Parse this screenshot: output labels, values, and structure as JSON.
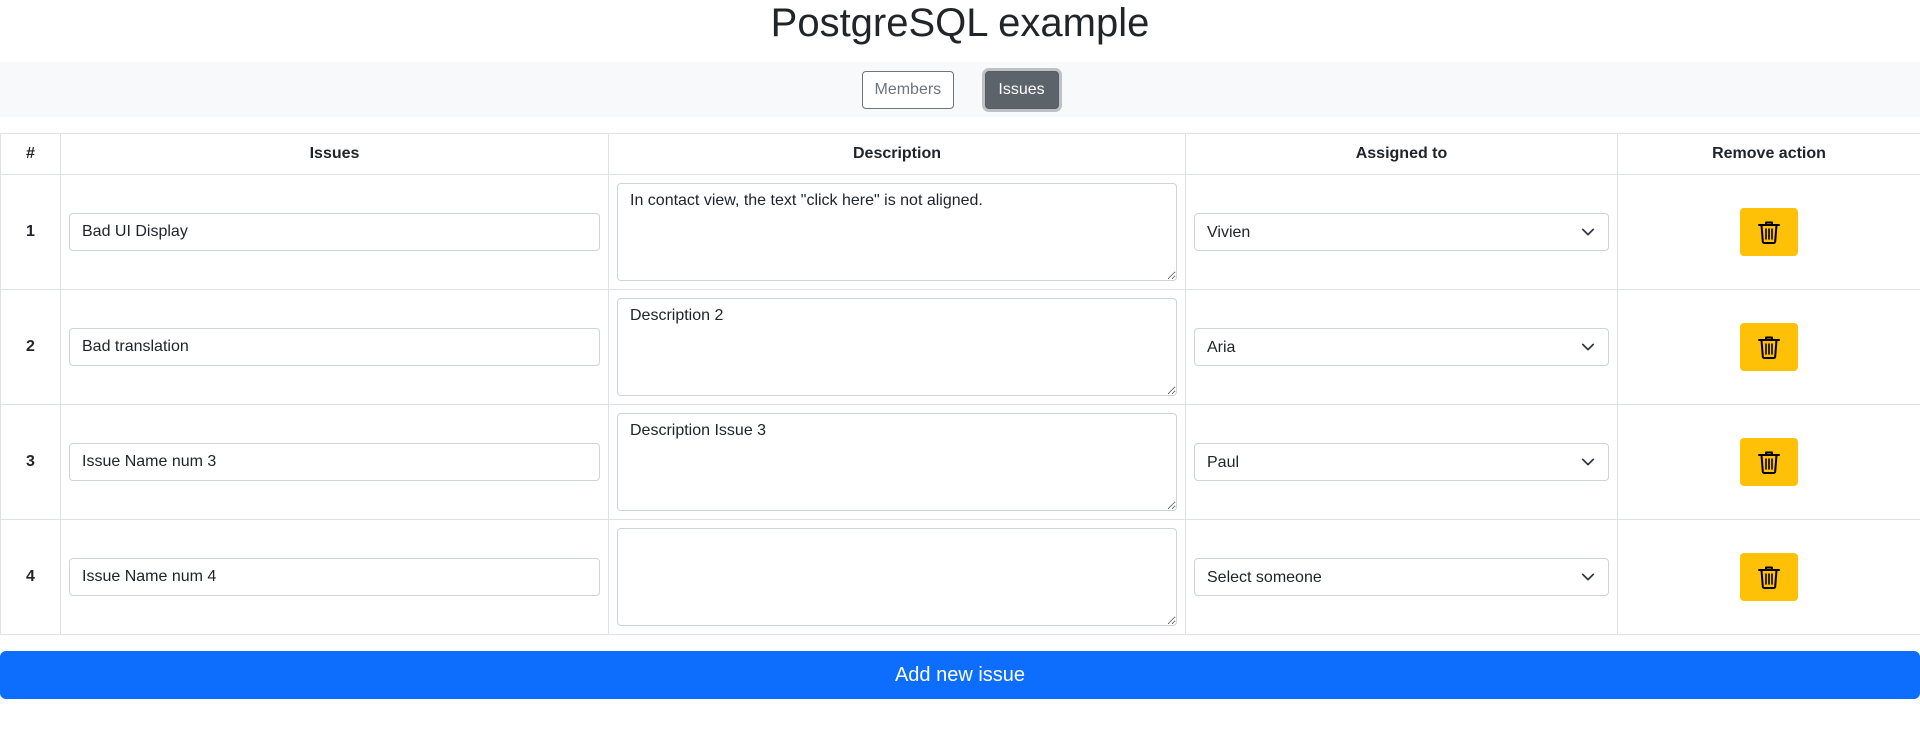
{
  "page": {
    "title": "PostgreSQL example"
  },
  "nav": {
    "members_label": "Members",
    "issues_label": "Issues",
    "active": "Issues"
  },
  "table": {
    "headers": [
      "#",
      "Issues",
      "Description",
      "Assigned to",
      "Remove action"
    ],
    "rows": [
      {
        "num": "1",
        "issue": "Bad UI Display",
        "description": "In contact view, the text \"click here\" is not aligned.",
        "assigned": "Vivien"
      },
      {
        "num": "2",
        "issue": "Bad translation",
        "description": "Description 2",
        "assigned": "Aria"
      },
      {
        "num": "3",
        "issue": "Issue Name num 3",
        "description": "Description Issue 3",
        "assigned": "Paul"
      },
      {
        "num": "4",
        "issue": "Issue Name num 4",
        "description": "",
        "assigned": "Select someone"
      }
    ]
  },
  "actions": {
    "add_issue_label": "Add new issue"
  },
  "icons": {
    "remove": "trash-icon",
    "select": "chevron-down-icon"
  },
  "colors": {
    "primary": "#0d6efd",
    "warning": "#ffc107",
    "secondary": "#6c757d"
  }
}
